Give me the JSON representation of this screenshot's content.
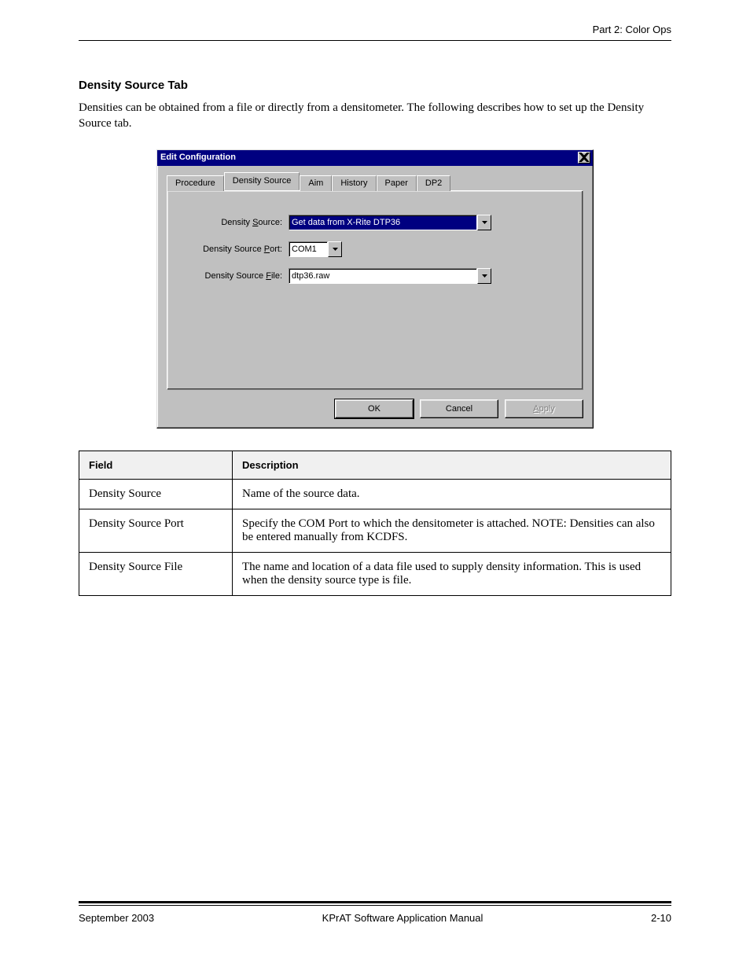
{
  "header": {
    "section_title": "Part 2: Color Ops"
  },
  "content": {
    "heading": "Density Source Tab",
    "intro": "Densities can be obtained from a file or directly from a densitometer. The following describes how to set up the Density Source tab.",
    "table": {
      "headers": [
        "Field",
        "Description"
      ],
      "rows": [
        [
          "Density Source",
          "Name of the source data."
        ],
        [
          "Density Source Port",
          "Specify the COM Port to which the densitometer is attached. NOTE: Densities can also be entered manually from KCDFS."
        ],
        [
          "Density Source File",
          "The name and location of a data file used to supply density information. This is used when the density source type is file."
        ]
      ]
    }
  },
  "dialog": {
    "title": "Edit Configuration",
    "tabs": [
      "Procedure",
      "Density Source",
      "Aim",
      "History",
      "Paper",
      "DP2"
    ],
    "active_tab_index": 1,
    "fields": {
      "density_source": {
        "label_pre": "Density ",
        "label_u": "S",
        "label_post": "ource:",
        "value": "Get data from X-Rite DTP36"
      },
      "density_source_port": {
        "label_pre": "Density Source ",
        "label_u": "P",
        "label_post": "ort:",
        "value": "COM1"
      },
      "density_source_file": {
        "label_pre": "Density Source ",
        "label_u": "F",
        "label_post": "ile:",
        "value": "dtp36.raw"
      }
    },
    "buttons": {
      "ok": "OK",
      "cancel": "Cancel",
      "apply_pre": "",
      "apply_u": "A",
      "apply_post": "pply"
    }
  },
  "footer": {
    "date": "September 2003",
    "manual": "KPrAT Software Application Manual",
    "page": "2-10"
  }
}
